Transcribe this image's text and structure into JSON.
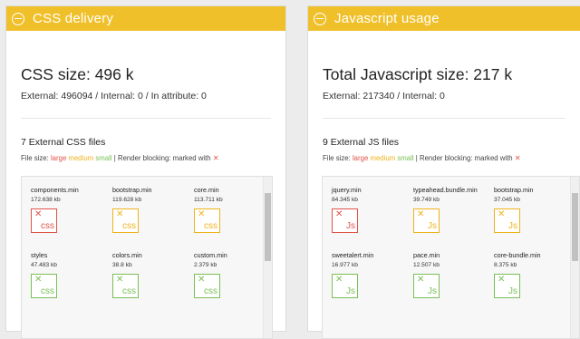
{
  "css_panel": {
    "title": "CSS delivery",
    "heading": "CSS size: 496 k",
    "subline": "External: 496094 / Internal: 0 / In attribute: 0",
    "count_label": "7 External CSS files",
    "legend": {
      "prefix": "File size:",
      "large": "large",
      "medium": "medium",
      "small": "small",
      "sep": "|",
      "render": "Render blocking: marked with",
      "marker": "✕"
    },
    "files": [
      {
        "name": "components.min",
        "size": "172.638 kb",
        "ext": "css",
        "category": "large"
      },
      {
        "name": "bootstrap.min",
        "size": "119.628 kb",
        "ext": "css",
        "category": "medium"
      },
      {
        "name": "core.min",
        "size": "113.711 kb",
        "ext": "css",
        "category": "medium"
      },
      {
        "name": "styles",
        "size": "47.483 kb",
        "ext": "css",
        "category": "small"
      },
      {
        "name": "colors.min",
        "size": "38.8 kb",
        "ext": "css",
        "category": "small"
      },
      {
        "name": "custom.min",
        "size": "2.379 kb",
        "ext": "css",
        "category": "small"
      }
    ]
  },
  "js_panel": {
    "title": "Javascript usage",
    "heading": "Total Javascript size: 217 k",
    "subline": "External: 217340 / Internal: 0",
    "count_label": "9 External JS files",
    "legend": {
      "prefix": "File size:",
      "large": "large",
      "medium": "medium",
      "small": "small",
      "sep": "|",
      "render": "Render blocking: marked with",
      "marker": "✕"
    },
    "files": [
      {
        "name": "jquery.min",
        "size": "84.345 kb",
        "ext": "Js",
        "category": "large"
      },
      {
        "name": "typeahead.bundle.min",
        "size": "39.749 kb",
        "ext": "Js",
        "category": "medium"
      },
      {
        "name": "bootstrap.min",
        "size": "37.045 kb",
        "ext": "Js",
        "category": "medium"
      },
      {
        "name": "sweetalert.min",
        "size": "16.977 kb",
        "ext": "Js",
        "category": "small"
      },
      {
        "name": "pace.min",
        "size": "12.507 kb",
        "ext": "Js",
        "category": "small"
      },
      {
        "name": "core-bundle.min",
        "size": "8.375 kb",
        "ext": "Js",
        "category": "small"
      }
    ]
  },
  "colors": {
    "header": "#f0c02a",
    "large": "#e2534a",
    "medium": "#efb31c",
    "small": "#7abf56"
  },
  "icons": {
    "collapse": "minus-circle-icon",
    "render_blocking": "x-mark-icon"
  }
}
